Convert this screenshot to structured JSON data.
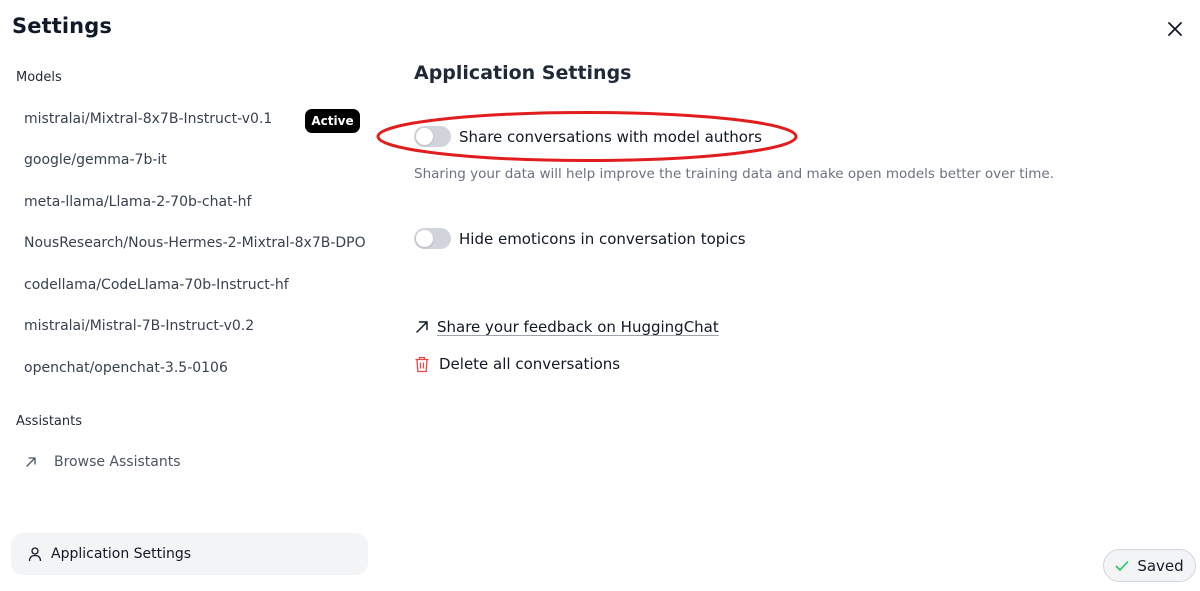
{
  "header": {
    "title": "Settings",
    "close_icon": "close-icon"
  },
  "sidebar": {
    "models_label": "Models",
    "models": [
      {
        "name": "mistralai/Mixtral-8x7B-Instruct-v0.1",
        "active": true
      },
      {
        "name": "google/gemma-7b-it"
      },
      {
        "name": "meta-llama/Llama-2-70b-chat-hf"
      },
      {
        "name": "NousResearch/Nous-Hermes-2-Mixtral-8x7B-DPO"
      },
      {
        "name": "codellama/CodeLlama-70b-Instruct-hf"
      },
      {
        "name": "mistralai/Mistral-7B-Instruct-v0.2"
      },
      {
        "name": "openchat/openchat-3.5-0106"
      }
    ],
    "active_badge": "Active",
    "assistants_label": "Assistants",
    "browse_assistants": "Browse Assistants",
    "application_settings": "Application Settings"
  },
  "main": {
    "title": "Application Settings",
    "share_toggle": {
      "label": "Share conversations with model authors",
      "enabled": false
    },
    "share_description": "Sharing your data will help improve the training data and make open models better over time.",
    "emoticons_toggle": {
      "label": "Hide emoticons in conversation topics",
      "enabled": false
    },
    "feedback_link": "Share your feedback on HuggingChat",
    "delete_link": "Delete all conversations"
  },
  "status": {
    "saved_label": "Saved"
  },
  "colors": {
    "highlight": "#e11d1d",
    "toggle_off": "#d1d5db",
    "active_badge_bg": "#000000",
    "trash": "#ef4444",
    "check": "#22c55e"
  }
}
